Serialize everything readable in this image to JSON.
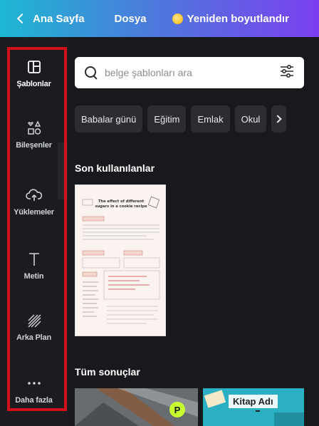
{
  "topbar": {
    "back_label": "Ana Sayfa",
    "file_label": "Dosya",
    "resize_label": "Yeniden boyutlandır"
  },
  "sidebar": {
    "items": [
      {
        "label": "Şablonlar",
        "icon": "template-icon",
        "active": true
      },
      {
        "label": "Bileşenler",
        "icon": "elements-icon",
        "active": false
      },
      {
        "label": "Yüklemeler",
        "icon": "upload-cloud-icon",
        "active": false
      },
      {
        "label": "Metin",
        "icon": "text-icon",
        "active": false
      },
      {
        "label": "Arka Plan",
        "icon": "background-icon",
        "active": false
      },
      {
        "label": "Daha fazla",
        "icon": "more-icon",
        "active": false
      }
    ]
  },
  "search": {
    "placeholder": "belge şablonları ara",
    "value": ""
  },
  "chips": [
    "Babalar günü",
    "Eğitim",
    "Emlak",
    "Okul"
  ],
  "recent": {
    "title": "Son kullanılanlar",
    "items": [
      {
        "thumb_title": "The effect of different sugars in a cookie recipe"
      }
    ]
  },
  "results": {
    "title": "Tüm sonuçlar",
    "items": [
      {
        "badge": "P"
      },
      {
        "label": "Kitap Adı"
      }
    ]
  },
  "colors": {
    "topbar_gradient_start": "#1db8d3",
    "topbar_gradient_end": "#7b3ff0",
    "sidebar_bg": "#1a1c20",
    "panel_bg": "#18191d",
    "chip_bg": "#2b2d33",
    "highlight_frame": "#d3111a"
  }
}
